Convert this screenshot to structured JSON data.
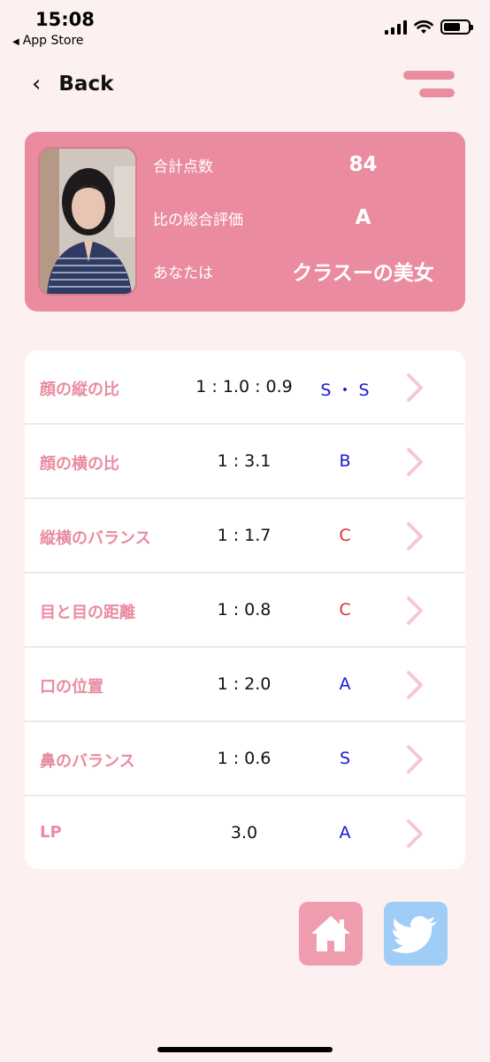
{
  "status_bar": {
    "time": "15:08",
    "back_app": "App Store"
  },
  "nav": {
    "back_label": "Back",
    "menu_icon": "hamburger-icon"
  },
  "summary": {
    "rows": [
      {
        "label": "合計点数",
        "value": "84"
      },
      {
        "label": "比の総合評価",
        "value": "A"
      },
      {
        "label": "あなたは",
        "value": "クラスーの美女"
      }
    ]
  },
  "results": [
    {
      "name": "顔の縦の比",
      "ratio": "1 : 1.0 : 0.9",
      "grade": "S ・ S",
      "grade_color": "#1a1ad6"
    },
    {
      "name": "顔の横の比",
      "ratio": "1 : 3.1",
      "grade": "B",
      "grade_color": "#1a1ad6"
    },
    {
      "name": "縦横のバランス",
      "ratio": "1 : 1.7",
      "grade": "C",
      "grade_color": "#d93030"
    },
    {
      "name": "目と目の距離",
      "ratio": "1 : 0.8",
      "grade": "C",
      "grade_color": "#d93030"
    },
    {
      "name": "口の位置",
      "ratio": "1 : 2.0",
      "grade": "A",
      "grade_color": "#1a1ad6"
    },
    {
      "name": "鼻のバランス",
      "ratio": "1 : 0.6",
      "grade": "S",
      "grade_color": "#1a1ad6"
    },
    {
      "name": "LP",
      "ratio": "3.0",
      "grade": "A",
      "grade_color": "#1a1ad6"
    }
  ],
  "colors": {
    "accent": "#ea8ba0",
    "background": "#fcf0f0",
    "twitter": "#9fcdf7",
    "home": "#ef9caf"
  },
  "buttons": {
    "home_icon": "home-icon",
    "twitter_icon": "twitter-bird-icon"
  }
}
